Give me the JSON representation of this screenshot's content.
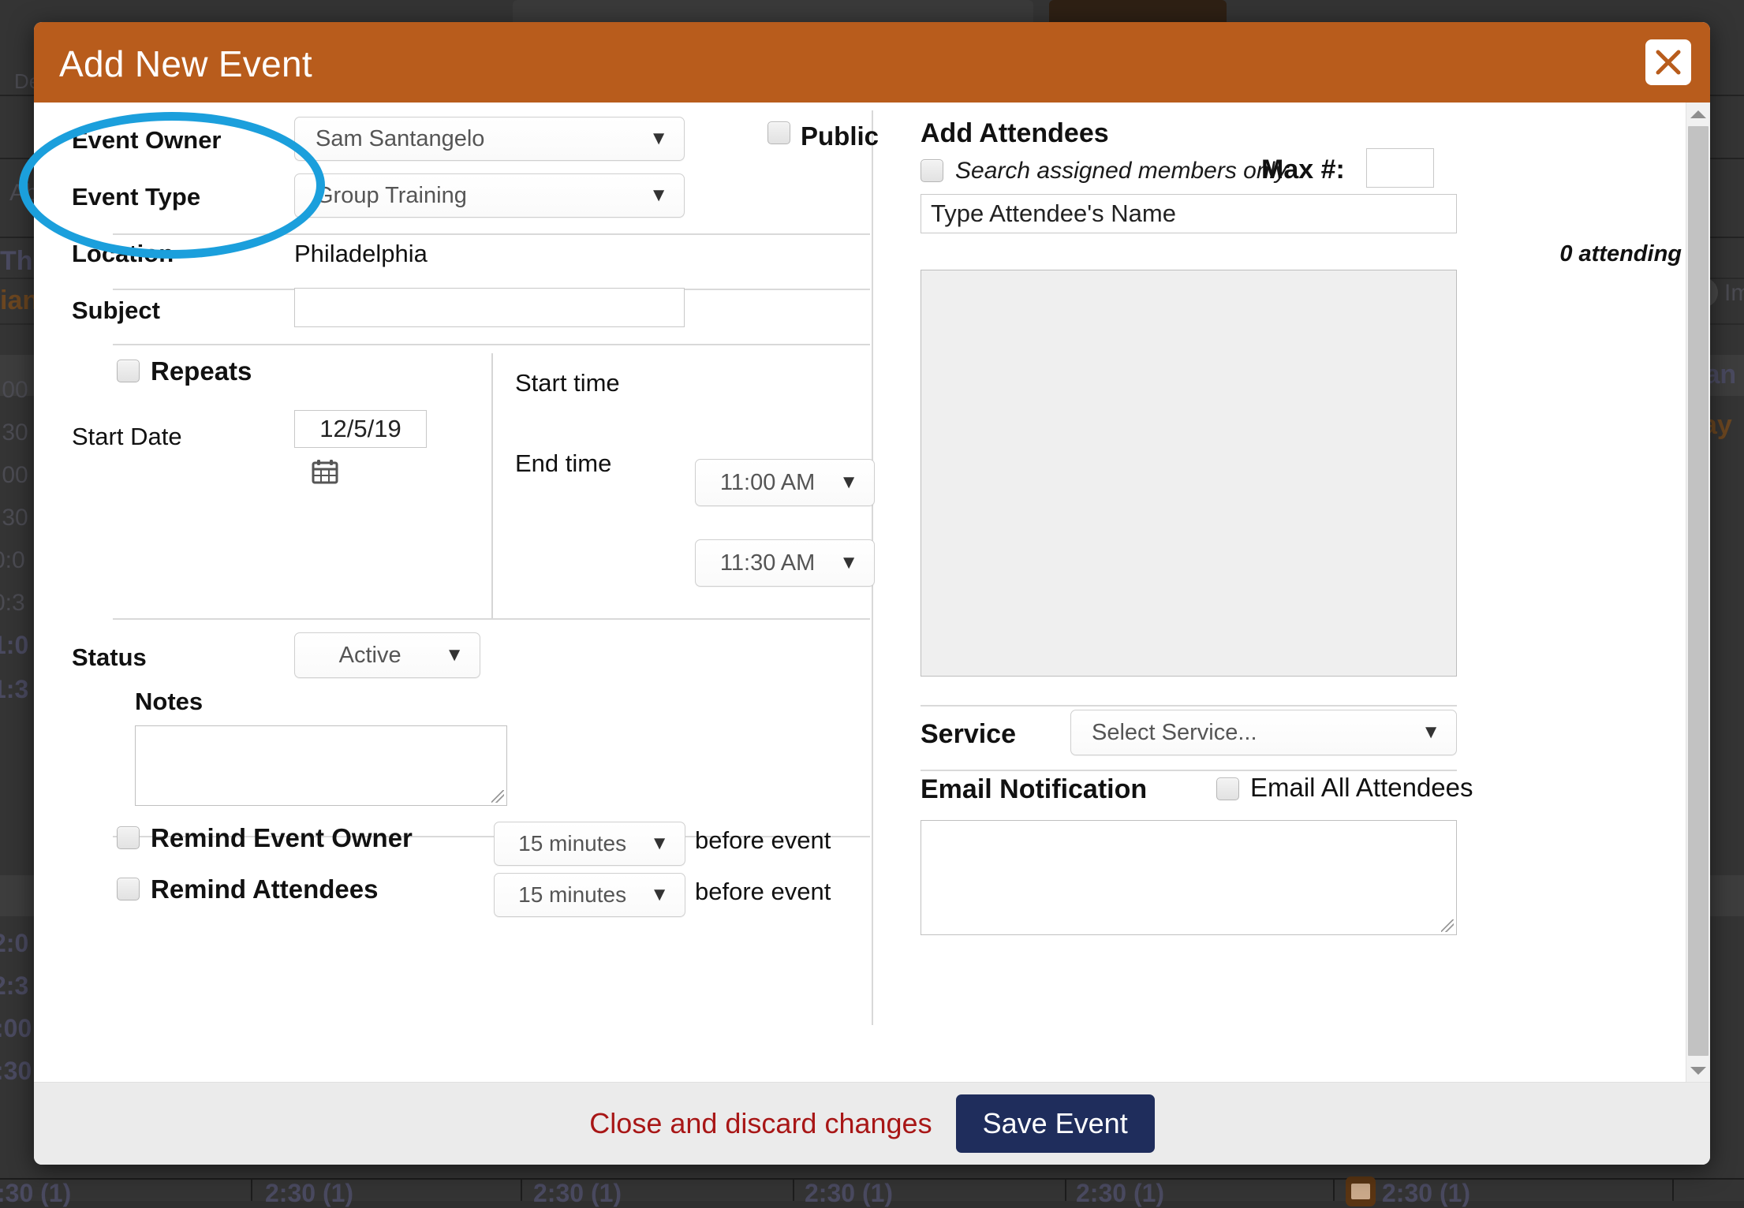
{
  "modal": {
    "title": "Add New Event",
    "close_icon": "close-icon"
  },
  "left": {
    "event_owner": {
      "label": "Event Owner",
      "value": "Sam Santangelo"
    },
    "event_type": {
      "label": "Event Type",
      "value": "Group Training"
    },
    "public": {
      "label": "Public",
      "checked": false
    },
    "location": {
      "label": "Location",
      "value": "Philadelphia"
    },
    "subject": {
      "label": "Subject",
      "value": ""
    },
    "repeats": {
      "label": "Repeats",
      "checked": false
    },
    "start_date": {
      "label": "Start Date",
      "value": "12/5/19",
      "icon": "calendar-icon"
    },
    "start_time": {
      "label": "Start time",
      "value": "11:00 AM"
    },
    "end_time": {
      "label": "End time",
      "value": "11:30 AM"
    },
    "status": {
      "label": "Status",
      "value": "Active"
    },
    "notes": {
      "label": "Notes",
      "value": ""
    },
    "remind_owner": {
      "label": "Remind Event Owner",
      "value": "15 minutes",
      "suffix": "before event",
      "checked": false
    },
    "remind_attendees": {
      "label": "Remind Attendees",
      "value": "15 minutes",
      "suffix": "before event",
      "checked": false
    }
  },
  "right": {
    "heading": "Add Attendees",
    "search_assigned": {
      "label": "Search assigned members only",
      "checked": false
    },
    "max": {
      "label": "Max #:",
      "value": ""
    },
    "attendee_input": {
      "placeholder": "Type Attendee's Name",
      "value": ""
    },
    "attending_count": "0 attending",
    "service": {
      "label": "Service",
      "value": "Select Service..."
    },
    "email_notification": {
      "label": "Email Notification",
      "value": ""
    },
    "email_all": {
      "label": "Email All Attendees",
      "checked": false
    }
  },
  "footer": {
    "discard": "Close and discard changes",
    "save": "Save Event"
  },
  "background": {
    "partial_texts": [
      "De",
      "Abl",
      "Thu",
      "ian S",
      "ay",
      "Im"
    ],
    "time_slots": [
      ":00",
      ":30",
      ":00",
      ":30",
      "0:0",
      "0:3",
      "1:0",
      "1:3",
      "2:0",
      "2:3",
      ":00",
      ":30"
    ],
    "bottom_cells": [
      ":30 (1)",
      "2:30 (1)",
      "2:30 (1)",
      "2:30 (1)",
      "2:30 (1)",
      "2:30 (1)"
    ]
  },
  "colors": {
    "header": "#b85c1c",
    "save": "#1f2d5c",
    "discard": "#a81616",
    "annotation": "#1b9fdc"
  }
}
